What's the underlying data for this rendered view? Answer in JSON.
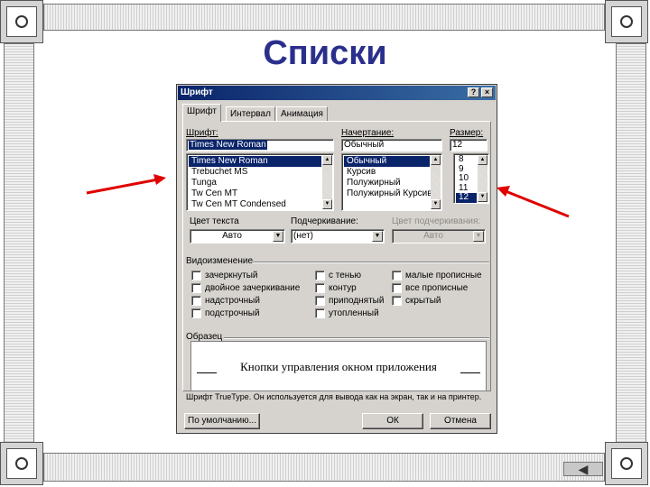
{
  "slide": {
    "title": "Списки"
  },
  "dialog": {
    "title": "Шрифт",
    "help_button": "?",
    "close_button": "×",
    "tabs": [
      "Шрифт",
      "Интервал",
      "Анимация"
    ],
    "font": {
      "label": "Шрифт:",
      "value": "Times New Roman",
      "list": [
        "Times New Roman",
        "Trebuchet MS",
        "Tunga",
        "Tw Cen MT",
        "Tw Cen MT Condensed"
      ],
      "selected_index": 0
    },
    "style": {
      "label": "Начертание:",
      "value": "Обычный",
      "list": [
        "Обычный",
        "Курсив",
        "Полужирный",
        "Полужирный Курсив"
      ],
      "selected_index": 0
    },
    "size": {
      "label": "Размер:",
      "value": "12",
      "list": [
        "8",
        "9",
        "10",
        "11",
        "12"
      ],
      "selected_index": 4
    },
    "font_color": {
      "label": "Цвет текста",
      "value": "Авто"
    },
    "underline": {
      "label": "Подчеркивание:",
      "value": "(нет)"
    },
    "underline_color": {
      "label": "Цвет подчеркивания:",
      "value": "Авто"
    },
    "effects": {
      "label": "Видоизменение",
      "col1": [
        "зачеркнутый",
        "двойное зачеркивание",
        "надстрочный",
        "подстрочный"
      ],
      "col2": [
        "с тенью",
        "контур",
        "приподнятый",
        "утопленный"
      ],
      "col3": [
        "малые прописные",
        "все прописные",
        "скрытый"
      ]
    },
    "preview": {
      "label": "Образец",
      "text": "Кнопки управления окном приложения"
    },
    "note": "Шрифт TrueType. Он используется для вывода как на экран, так и на принтер.",
    "buttons": {
      "default": "По умолчанию...",
      "ok": "ОК",
      "cancel": "Отмена"
    }
  },
  "colors": {
    "title": "#2b2f8c",
    "dialog_bg": "#d6d3ce",
    "titlebar": "#0a246a",
    "arrows": "#e00000"
  },
  "nav": {
    "back_icon": "◀"
  }
}
